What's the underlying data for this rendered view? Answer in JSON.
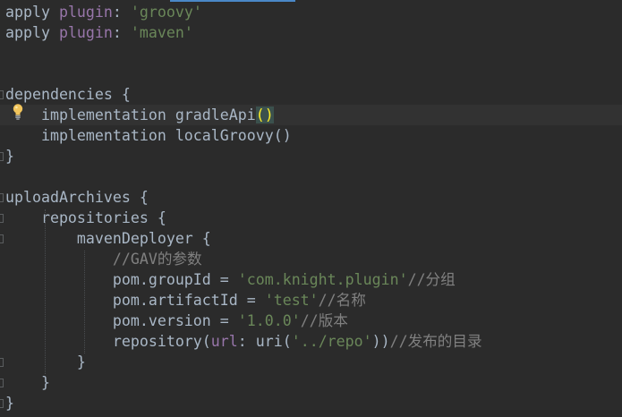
{
  "editor": {
    "lines": [
      {
        "segments": [
          {
            "t": "apply "
          },
          {
            "t": "plugin",
            "c": "named"
          },
          {
            "t": ": "
          },
          {
            "t": "'groovy'",
            "c": "str"
          }
        ]
      },
      {
        "segments": [
          {
            "t": "apply "
          },
          {
            "t": "plugin",
            "c": "named"
          },
          {
            "t": ": "
          },
          {
            "t": "'maven'",
            "c": "str"
          }
        ]
      },
      {
        "segments": []
      },
      {
        "segments": []
      },
      {
        "segments": [
          {
            "t": "dependencies {"
          }
        ]
      },
      {
        "segments": [
          {
            "t": "    implementation gradleApi"
          },
          {
            "t": "()",
            "c": "match"
          }
        ],
        "current": true
      },
      {
        "segments": [
          {
            "t": "    implementation localGroovy()"
          }
        ]
      },
      {
        "segments": [
          {
            "t": "}"
          }
        ]
      },
      {
        "segments": []
      },
      {
        "segments": [
          {
            "t": "uploadArchives {"
          }
        ]
      },
      {
        "segments": [
          {
            "t": "    repositories {"
          }
        ]
      },
      {
        "segments": [
          {
            "t": "        mavenDeployer {"
          }
        ]
      },
      {
        "segments": [
          {
            "t": "            //GAV的参数",
            "c": "cmt"
          }
        ]
      },
      {
        "segments": [
          {
            "t": "            pom.groupId = "
          },
          {
            "t": "'com.knight.plugin'",
            "c": "str"
          },
          {
            "t": "//分组",
            "c": "cmt"
          }
        ]
      },
      {
        "segments": [
          {
            "t": "            pom.artifactId = "
          },
          {
            "t": "'test'",
            "c": "str"
          },
          {
            "t": "//名称",
            "c": "cmt"
          }
        ]
      },
      {
        "segments": [
          {
            "t": "            pom.version = "
          },
          {
            "t": "'1.0.0'",
            "c": "str"
          },
          {
            "t": "//版本",
            "c": "cmt"
          }
        ]
      },
      {
        "segments": [
          {
            "t": "            repository("
          },
          {
            "t": "url",
            "c": "named"
          },
          {
            "t": ": uri("
          },
          {
            "t": "'../repo'",
            "c": "str"
          },
          {
            "t": "))"
          },
          {
            "t": "//发布的目录",
            "c": "cmt"
          }
        ]
      },
      {
        "segments": [
          {
            "t": "        }"
          }
        ]
      },
      {
        "segments": [
          {
            "t": "    }"
          }
        ]
      },
      {
        "segments": [
          {
            "t": "}"
          }
        ]
      }
    ],
    "intention_icon": "lightbulb-icon",
    "colors": {
      "background": "#2b2b2b",
      "text": "#a9b7c6",
      "string": "#6a8759",
      "named_arg": "#9876aa",
      "comment": "#808080",
      "brace_match": "#ffef28"
    }
  }
}
